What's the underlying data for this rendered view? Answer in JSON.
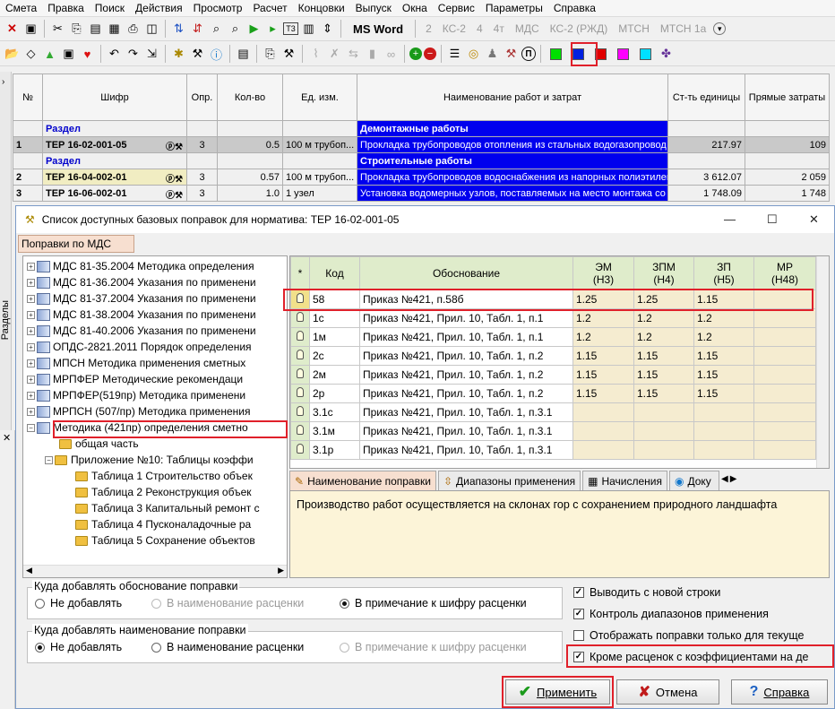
{
  "menu": [
    "Смета",
    "Правка",
    "Поиск",
    "Действия",
    "Просмотр",
    "Расчет",
    "Концовки",
    "Выпуск",
    "Окна",
    "Сервис",
    "Параметры",
    "Справка"
  ],
  "toolbar2": {
    "msword": "MS Word",
    "items": [
      "2",
      "КС-2",
      "4",
      "4т",
      "МДС",
      "КС-2 (РЖД)",
      "МТСН",
      "МТСН 1а"
    ]
  },
  "toolbar3": {
    "p_button": "П"
  },
  "colors": {
    "selection": "#0000ee",
    "highlight_box": "#e0202a",
    "coef_bg": "#f5ecd0",
    "header_green": "#dfeccb",
    "note_bg": "#fcf4d8"
  },
  "sidebar": {
    "label": "Разделы"
  },
  "main_table": {
    "headers": [
      "№",
      "Шифр",
      "Опр.",
      "Кол-во",
      "Ед. изм.",
      "Наименование работ и затрат",
      "Ст-ть единицы",
      "Прямые затраты"
    ],
    "rows": [
      {
        "type": "section",
        "label": "Раздел",
        "name": "Демонтажные работы"
      },
      {
        "type": "item",
        "num": "1",
        "code": "ТЕР 16-02-001-05",
        "opr": "3",
        "qty": "0.5",
        "unit": "100 м трубоп...",
        "name": "Прокладка трубопроводов отопления из стальных водогазопровод",
        "unit_cost": "217.97",
        "direct": "109"
      },
      {
        "type": "section",
        "label": "Раздел",
        "name": "Строительные работы"
      },
      {
        "type": "item",
        "num": "2",
        "code": "ТЕР 16-04-002-01",
        "opr": "3",
        "qty": "0.57",
        "unit": "100 м трубоп...",
        "name": "Прокладка трубопроводов водоснабжения из напорных полиэтилен",
        "unit_cost": "3 612.07",
        "direct": "2 059"
      },
      {
        "type": "item",
        "num": "3",
        "code": "ТЕР 16-06-002-01",
        "opr": "3",
        "qty": "1.0",
        "unit": "1 узел",
        "name": "Установка водомерных узлов, поставляемых на место монтажа со",
        "unit_cost": "1 748.09",
        "direct": "1 748"
      }
    ]
  },
  "dialog": {
    "title": "Список доступных базовых поправок для норматива: ТЕР 16-02-001-05",
    "tab": "Поправки по МДС",
    "tree": [
      "МДС 81-35.2004 Методика определения",
      "МДС 81-36.2004 Указания по применени",
      "МДС 81-37.2004 Указания по применени",
      "МДС 81-38.2004 Указания по применени",
      "МДС 81-40.2006 Указания по применени",
      "ОПДС-2821.2011 Порядок определения",
      "МПСН Методика применения сметных",
      "МРПФЕР Методические рекомендаци",
      "МРПФЕР(519пр) Методика применени",
      "МРПСН (507/пр) Методика применения",
      "Методика (421пр) определения сметно"
    ],
    "tree_children": [
      "общая часть",
      "Приложение №10: Таблицы коэффи"
    ],
    "tree_grandchildren": [
      "Таблица 1 Строительство объек",
      "Таблица 2 Реконструкция объек",
      "Таблица 3 Капитальный ремонт с",
      "Таблица 4 Пусконаладочные ра",
      "Таблица 5 Сохранение объектов"
    ],
    "grid_headers": {
      "star": "*",
      "code": "Код",
      "basis": "Обоснование",
      "em": "ЭМ",
      "em_sub": "(Н3)",
      "zpm": "ЗПМ",
      "zpm_sub": "(Н4)",
      "zp": "ЗП",
      "zp_sub": "(Н5)",
      "mr": "МР",
      "mr_sub": "(Н48)"
    },
    "grid_rows": [
      {
        "code": "58",
        "basis": "Приказ №421, п.58б",
        "em": "1.25",
        "zpm": "1.25",
        "zp": "1.15",
        "mr": ""
      },
      {
        "code": "1с",
        "basis": "Приказ №421, Прил. 10, Табл. 1, п.1",
        "em": "1.2",
        "zpm": "1.2",
        "zp": "1.2",
        "mr": ""
      },
      {
        "code": "1м",
        "basis": "Приказ №421, Прил. 10, Табл. 1, п.1",
        "em": "1.2",
        "zpm": "1.2",
        "zp": "1.2",
        "mr": ""
      },
      {
        "code": "2с",
        "basis": "Приказ №421, Прил. 10, Табл. 1, п.2",
        "em": "1.15",
        "zpm": "1.15",
        "zp": "1.15",
        "mr": ""
      },
      {
        "code": "2м",
        "basis": "Приказ №421, Прил. 10, Табл. 1, п.2",
        "em": "1.15",
        "zpm": "1.15",
        "zp": "1.15",
        "mr": ""
      },
      {
        "code": "2р",
        "basis": "Приказ №421, Прил. 10, Табл. 1, п.2",
        "em": "1.15",
        "zpm": "1.15",
        "zp": "1.15",
        "mr": ""
      },
      {
        "code": "3.1с",
        "basis": "Приказ №421, Прил. 10, Табл. 1, п.3.1",
        "em": "",
        "zpm": "",
        "zp": "",
        "mr": ""
      },
      {
        "code": "3.1м",
        "basis": "Приказ №421, Прил. 10, Табл. 1, п.3.1",
        "em": "",
        "zpm": "",
        "zp": "",
        "mr": ""
      },
      {
        "code": "3.1р",
        "basis": "Приказ №421, Прил. 10, Табл. 1, п.3.1",
        "em": "",
        "zpm": "",
        "zp": "",
        "mr": ""
      }
    ],
    "lower_tabs": [
      "Наименование поправки",
      "Диапазоны применения",
      "Начисления",
      "Доку"
    ],
    "note_text": "Производство работ осуществляется на склонах гор с сохранением природного ландшафта",
    "group1": {
      "title": "Куда добавлять обоснование поправки",
      "options": [
        "Не добавлять",
        "В наименование расценки",
        "В примечание к шифру расценки"
      ],
      "selected": 2
    },
    "group2": {
      "title": "Куда добавлять наименование поправки",
      "options": [
        "Не добавлять",
        "В наименование расценки",
        "В примечание к шифру расценки"
      ],
      "selected": 0
    },
    "checkboxes": [
      {
        "label": "Выводить с новой строки",
        "checked": true
      },
      {
        "label": "Контроль диапазонов применения",
        "checked": true
      },
      {
        "label": "Отображать поправки только для текуще",
        "checked": false
      },
      {
        "label": "Кроме расценок с коэффициентами на де",
        "checked": true
      }
    ],
    "buttons": {
      "apply": "Применить",
      "cancel": "Отмена",
      "help": "Справка"
    }
  }
}
